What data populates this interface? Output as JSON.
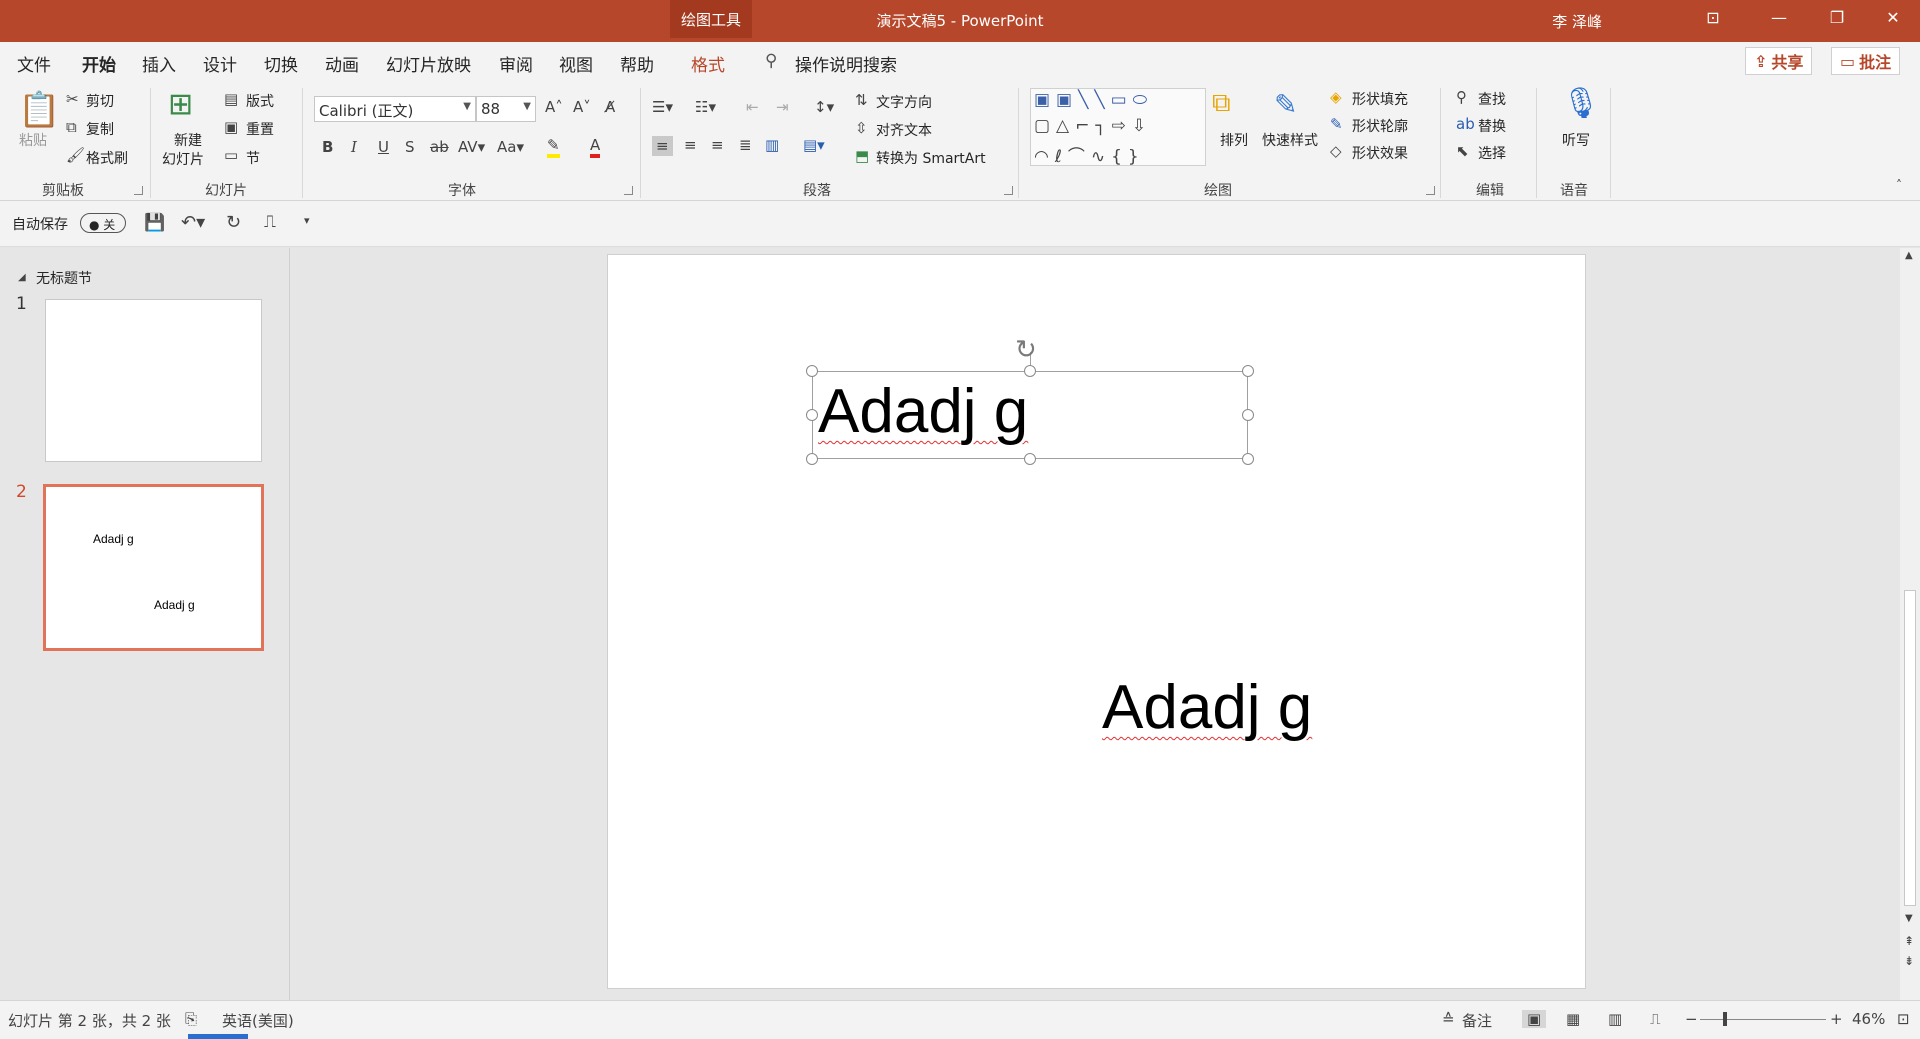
{
  "title": {
    "context_tab": "绘图工具",
    "document": "演示文稿5  -  PowerPoint",
    "user": "李 泽峰"
  },
  "tabs": [
    "文件",
    "开始",
    "插入",
    "设计",
    "切换",
    "动画",
    "幻灯片放映",
    "审阅",
    "视图",
    "帮助",
    "格式"
  ],
  "tell_me": "操作说明搜索",
  "share_label": "共享",
  "comment_label": "批注",
  "ribbon": {
    "clipboard": {
      "paste": "粘贴",
      "cut": "剪切",
      "copy": "复制",
      "format_painter": "格式刷",
      "label": "剪贴板"
    },
    "slides": {
      "new_slide_1": "新建",
      "new_slide_2": "幻灯片",
      "layout": "版式",
      "reset": "重置",
      "section": "节",
      "label": "幻灯片"
    },
    "font": {
      "name": "Calibri (正文)",
      "size": "88",
      "label": "字体"
    },
    "paragraph": {
      "text_direction": "文字方向",
      "align_text": "对齐文本",
      "smartart": "转换为 SmartArt",
      "label": "段落"
    },
    "drawing": {
      "arrange": "排列",
      "quick_styles": "快速样式",
      "fill": "形状填充",
      "outline": "形状轮廓",
      "effects": "形状效果",
      "label": "绘图"
    },
    "editing": {
      "find": "查找",
      "replace": "替换",
      "select": "选择",
      "label": "编辑"
    },
    "voice": {
      "dictate": "听写",
      "label": "语音"
    }
  },
  "qat": {
    "autosave": "自动保存",
    "autosave_state": "关"
  },
  "pane": {
    "section": "无标题节"
  },
  "slides": [
    {
      "number": "1",
      "texts": []
    },
    {
      "number": "2",
      "texts": [
        "Adadj g",
        "Adadj g"
      ]
    }
  ],
  "canvas": {
    "text1": "Adadj g",
    "text2": "Adadj g"
  },
  "status": {
    "slide_info": "幻灯片 第 2 张，共 2 张",
    "language": "英语(美国)",
    "notes": "备注",
    "zoom": "46%"
  },
  "colors": {
    "accent": "#b7472a",
    "selection": "#e0735a"
  }
}
